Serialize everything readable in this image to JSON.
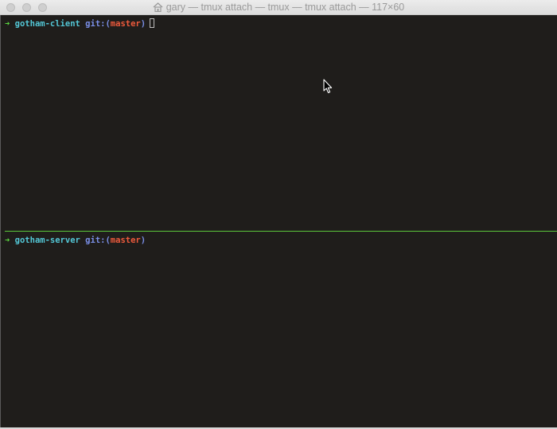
{
  "window": {
    "title": "gary — tmux attach — tmux — tmux attach — 117×60",
    "title_icon": "home-icon"
  },
  "colors": {
    "background": "#1f1d1b",
    "arrow": "#59d73f",
    "directory": "#53c7d6",
    "git": "#7a8fe8",
    "branch": "#ee5a3c",
    "divider": "#5cc83b"
  },
  "panes": [
    {
      "arrow": "➜",
      "directory": "gotham-client",
      "git_label": "git:",
      "open_paren": "(",
      "branch": "master",
      "close_paren": ")",
      "active": true
    },
    {
      "arrow": "➜",
      "directory": "gotham-server",
      "git_label": "git:",
      "open_paren": "(",
      "branch": "master",
      "close_paren": ")",
      "active": false
    }
  ]
}
